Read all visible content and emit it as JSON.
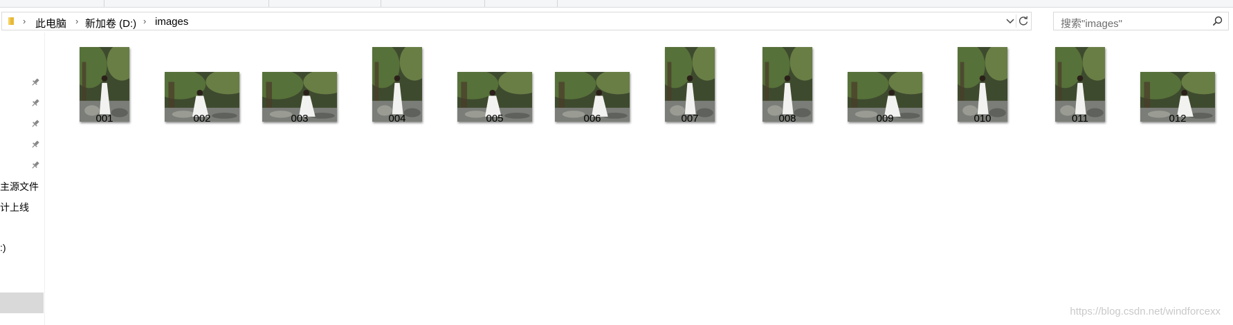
{
  "ribbon": {
    "tabs": [
      "",
      "",
      "",
      "",
      ""
    ]
  },
  "address_bar": {
    "crumbs": [
      "此电脑",
      "新加卷 (D:)",
      "images"
    ]
  },
  "search": {
    "placeholder": "搜索\"images\""
  },
  "nav": {
    "items": [
      "主源文件",
      "计上线",
      ":)"
    ]
  },
  "files": [
    {
      "name": "001",
      "orientation": "portrait"
    },
    {
      "name": "002",
      "orientation": "landscape"
    },
    {
      "name": "003",
      "orientation": "landscape"
    },
    {
      "name": "004",
      "orientation": "portrait"
    },
    {
      "name": "005",
      "orientation": "landscape"
    },
    {
      "name": "006",
      "orientation": "landscape"
    },
    {
      "name": "007",
      "orientation": "portrait"
    },
    {
      "name": "008",
      "orientation": "portrait"
    },
    {
      "name": "009",
      "orientation": "landscape"
    },
    {
      "name": "010",
      "orientation": "portrait"
    },
    {
      "name": "011",
      "orientation": "portrait"
    },
    {
      "name": "012",
      "orientation": "landscape"
    }
  ],
  "watermark": "https://blog.csdn.net/windforcexx",
  "colors": {
    "forest_dark": "#3e4a2e",
    "forest_green": "#5d7a3c",
    "dress_white": "#f2f2f0",
    "rock_gray": "#7b7e78"
  }
}
